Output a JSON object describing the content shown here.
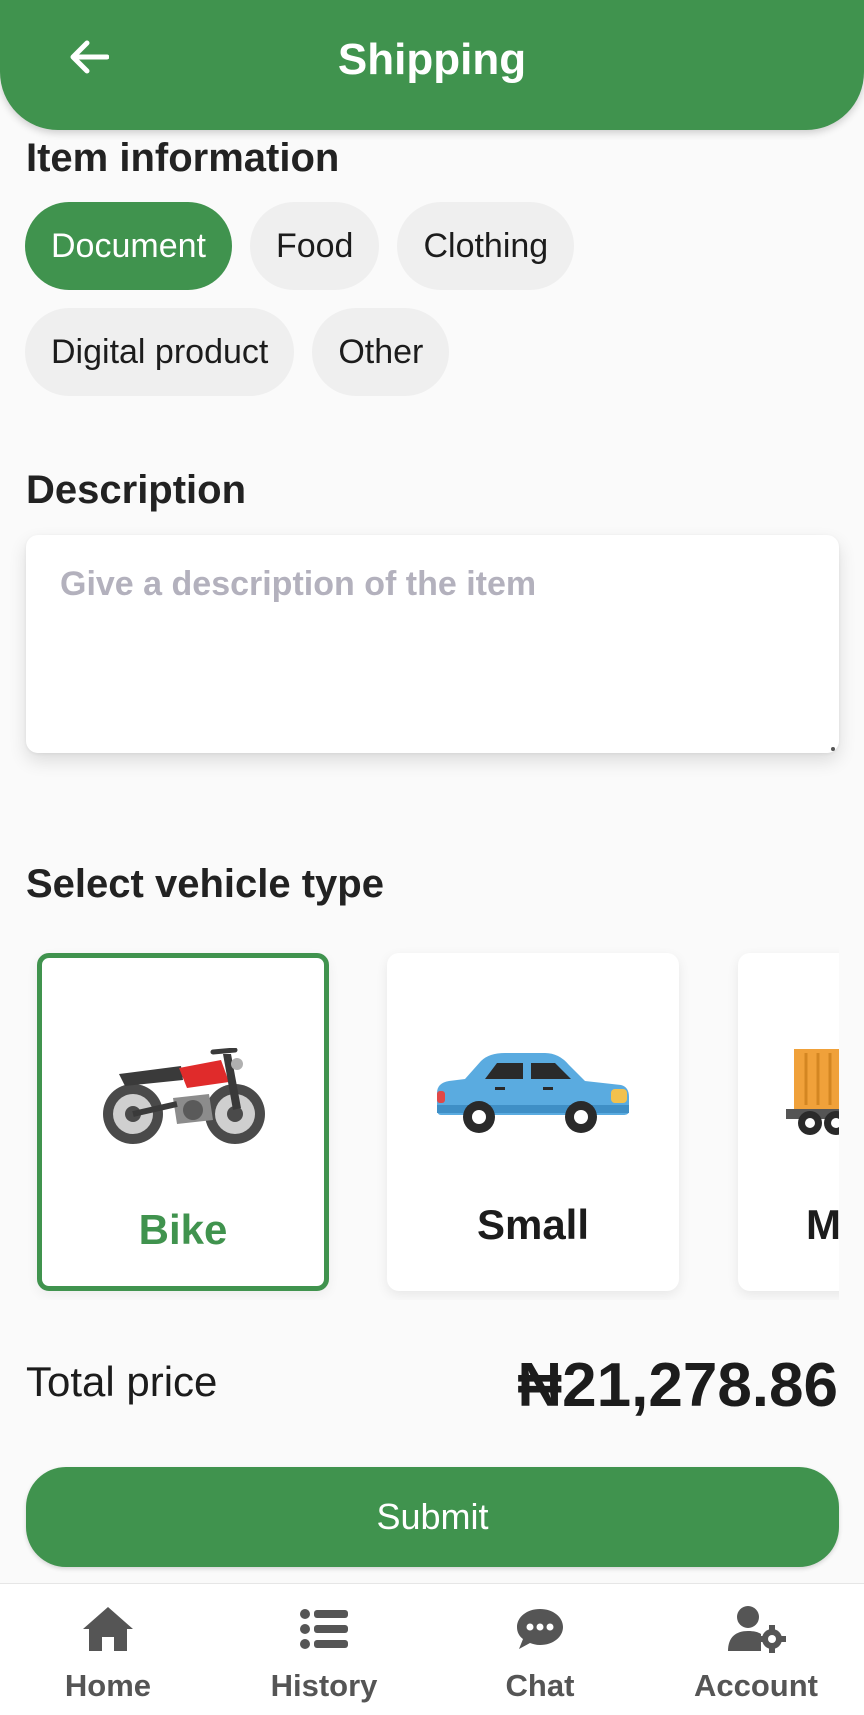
{
  "header": {
    "title": "Shipping",
    "back_icon": "arrow-left-icon"
  },
  "item_info": {
    "title": "Item information",
    "categories": [
      {
        "label": "Document",
        "selected": true
      },
      {
        "label": "Food",
        "selected": false
      },
      {
        "label": "Clothing",
        "selected": false
      },
      {
        "label": "Digital product",
        "selected": false
      },
      {
        "label": "Other",
        "selected": false
      }
    ]
  },
  "description": {
    "title": "Description",
    "value": "",
    "placeholder": "Give a description of the item"
  },
  "vehicle": {
    "title": "Select vehicle type",
    "options": [
      {
        "label": "Bike",
        "icon": "motorbike-icon",
        "selected": true
      },
      {
        "label": "Small",
        "icon": "car-icon",
        "selected": false
      },
      {
        "label": "M",
        "icon": "truck-icon",
        "selected": false
      }
    ]
  },
  "total": {
    "label": "Total price",
    "value": "₦21,278.86"
  },
  "submit": {
    "label": "Submit"
  },
  "nav": {
    "items": [
      {
        "label": "Home",
        "icon": "home-icon"
      },
      {
        "label": "History",
        "icon": "list-icon"
      },
      {
        "label": "Chat",
        "icon": "chat-bubble-icon"
      },
      {
        "label": "Account",
        "icon": "user-settings-icon"
      }
    ]
  },
  "colors": {
    "primary": "#40934e",
    "chip_bg": "#efefef",
    "placeholder": "#b3b1bd"
  }
}
